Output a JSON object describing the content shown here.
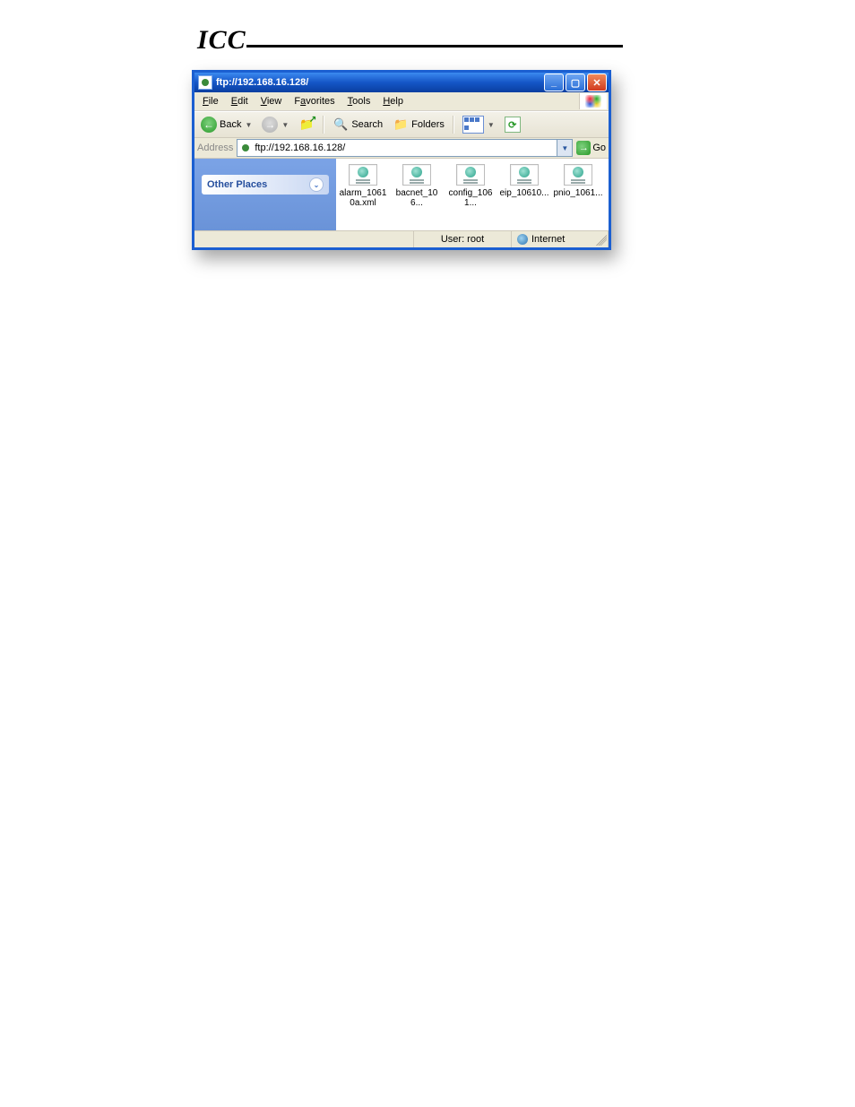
{
  "header": {
    "logo": "ICC"
  },
  "window": {
    "title": "ftp://192.168.16.128/",
    "menus": {
      "file": "File",
      "edit": "Edit",
      "view": "View",
      "favorites": "Favorites",
      "tools": "Tools",
      "help": "Help"
    },
    "toolbar": {
      "back": "Back",
      "search": "Search",
      "folders": "Folders"
    },
    "address": {
      "label": "Address",
      "value": "ftp://192.168.16.128/",
      "go": "Go"
    },
    "tasks": {
      "other_places": "Other Places"
    },
    "files": [
      {
        "name": "alarm_10610a.xml"
      },
      {
        "name": "bacnet_106..."
      },
      {
        "name": "config_1061..."
      },
      {
        "name": "eip_10610..."
      },
      {
        "name": "pnio_1061..."
      }
    ],
    "status": {
      "user": "User: root",
      "zone": "Internet"
    }
  }
}
